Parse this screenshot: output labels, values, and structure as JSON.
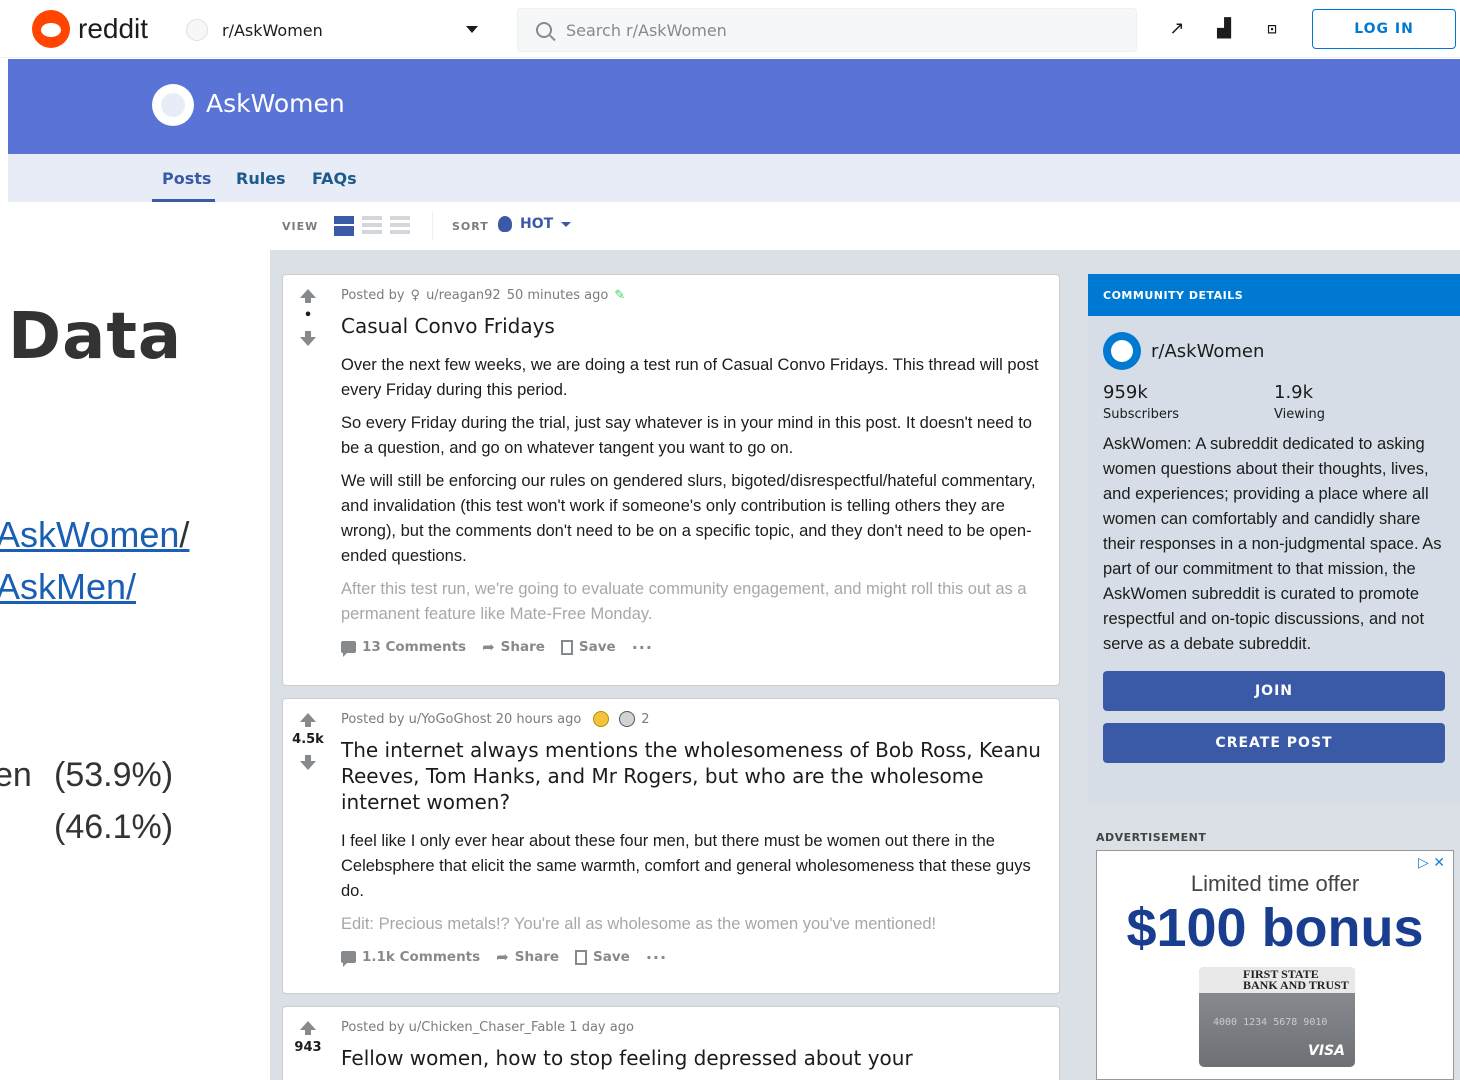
{
  "header": {
    "logo_text": "reddit",
    "subreddit": "r/AskWomen",
    "search_placeholder": "Search r/AskWomen",
    "login_label": "LOG IN"
  },
  "banner": {
    "title": "AskWomen"
  },
  "tabs": [
    {
      "label": "Posts"
    },
    {
      "label": "Rules"
    },
    {
      "label": "FAQs"
    }
  ],
  "viewbar": {
    "view_label": "VIEW",
    "sort_label": "SORT",
    "sort_value": "HOT"
  },
  "slide": {
    "title": "Data",
    "links": [
      "AskWomen",
      "AskMen/"
    ],
    "link_suffix": "/",
    "stat_prefix": "en",
    "stats": [
      "(53.9%)",
      "(46.1%)"
    ]
  },
  "posts": [
    {
      "meta_prefix": "Posted by",
      "author": "u/reagan92",
      "time": "50 minutes ago",
      "score": "•",
      "title": "Casual Convo Fridays",
      "paragraphs": [
        "Over the next few weeks, we are doing a test run of Casual Convo Fridays. This thread will post every Friday during this period.",
        "So every Friday during the trial, just say whatever is in your mind in this post. It doesn't need to be a question, and go on whatever tangent you want to go on.",
        "We will still be enforcing our rules on gendered slurs, bigoted/disrespectful/hateful commentary, and invalidation (this test won't work if someone's only contribution is telling others they are wrong), but the comments don't need to be on a specific topic, and they don't need to be open-ended questions."
      ],
      "faded": "After this test run, we're going to evaluate community engagement, and might roll this out as a permanent feature like Mate-Free Monday.",
      "comments": "13 Comments",
      "share": "Share",
      "save": "Save"
    },
    {
      "meta": "Posted by u/YoGoGhost 20 hours ago",
      "award_count": "2",
      "score": "4.5k",
      "title": "The internet always mentions the wholesomeness of Bob Ross, Keanu Reeves, Tom Hanks, and Mr Rogers, but who are the wholesome internet women?",
      "paragraphs": [
        "I feel like I only ever hear about these four men, but there must be women out there in the Celebsphere that elicit the same warmth, comfort and general wholesomeness that these guys do."
      ],
      "faded": "Edit: Precious metals!? You're all as wholesome as the women you've mentioned!",
      "comments": "1.1k Comments",
      "share": "Share",
      "save": "Save"
    },
    {
      "meta": "Posted by u/Chicken_Chaser_Fable 1 day ago",
      "score": "943",
      "title": "Fellow women, how to stop feeling depressed about your"
    }
  ],
  "sidebar": {
    "head": "COMMUNITY DETAILS",
    "name": "r/AskWomen",
    "subscribers": "959k",
    "subscribers_label": "Subscribers",
    "viewing": "1.9k",
    "viewing_label": "Viewing",
    "description": "AskWomen: A subreddit dedicated to asking women questions about their thoughts, lives, and experiences; providing a place where all women can comfortably and candidly share their responses in a non-judgmental space. As part of our commitment to that mission, the AskWomen subreddit is curated to promote respectful and on-topic discussions, and not serve as a debate subreddit.",
    "join": "JOIN",
    "create_post": "CREATE POST"
  },
  "ad": {
    "label": "ADVERTISEMENT",
    "close": "▷ ✕",
    "line1": "Limited time offer",
    "line2": "$100 bonus",
    "card_brand": "FIRST STATE BANK AND TRUST",
    "card_number": "4000 1234 5678 9010",
    "card_network": "VISA"
  },
  "colors": {
    "brand": "#ff4500",
    "banner": "#5a73d6",
    "accent": "#3a5aa8",
    "link": "#0079d3"
  }
}
